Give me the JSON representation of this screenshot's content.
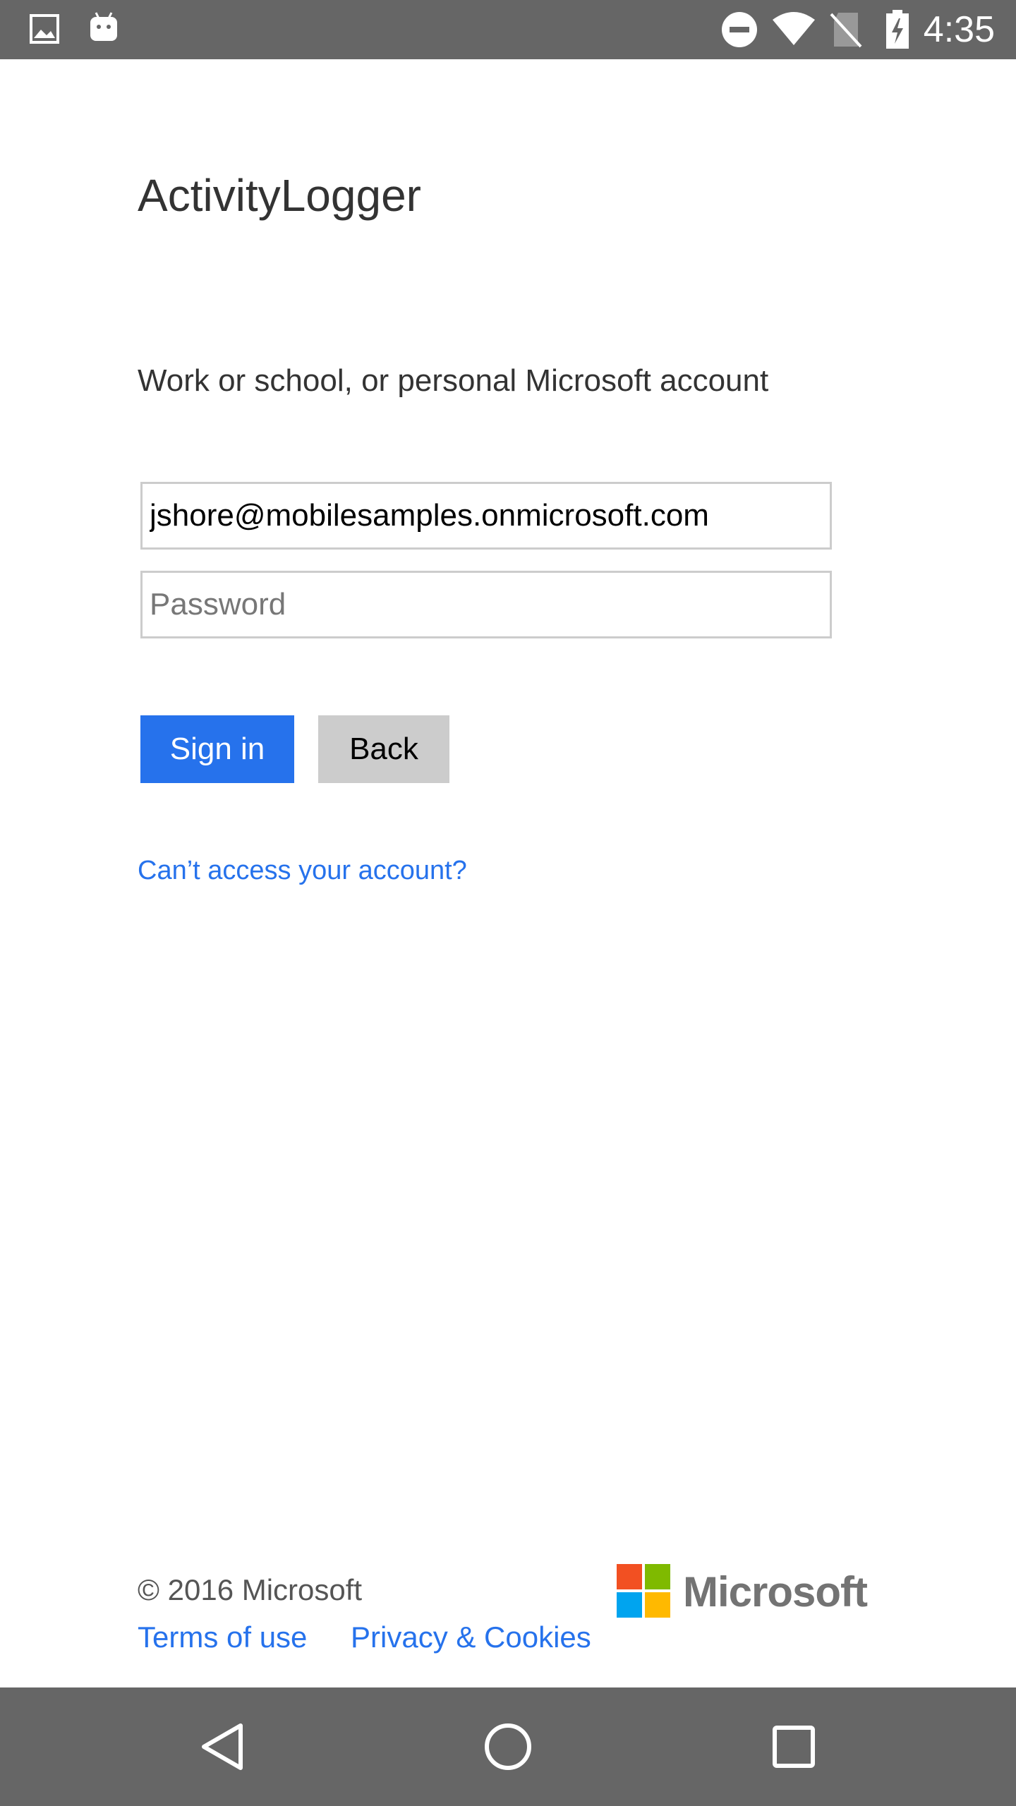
{
  "status_bar": {
    "time": "4:35",
    "left_icons": [
      "image-icon",
      "android-icon"
    ],
    "right_icons": [
      "do-not-disturb-icon",
      "wifi-icon",
      "no-sim-icon",
      "battery-charging-icon"
    ]
  },
  "app": {
    "title": "ActivityLogger"
  },
  "form": {
    "subtitle": "Work or school, or personal Microsoft account",
    "email_value": "jshore@mobilesamples.onmicrosoft.com",
    "password_placeholder": "Password",
    "sign_in_label": "Sign in",
    "back_label": "Back",
    "cant_access_label": "Can’t access your account?"
  },
  "footer": {
    "copyright": "© 2016 Microsoft",
    "terms_label": "Terms of use",
    "privacy_label": "Privacy & Cookies",
    "logo_text": "Microsoft"
  },
  "nav_bar": {
    "buttons": [
      "back-icon",
      "home-icon",
      "recents-icon"
    ]
  },
  "colors": {
    "accent": "#2672ec",
    "system_bars": "#666666",
    "back_button": "#cccccc",
    "logo_red": "#f25022",
    "logo_green": "#7fba00",
    "logo_blue": "#00a4ef",
    "logo_yellow": "#ffb900"
  }
}
